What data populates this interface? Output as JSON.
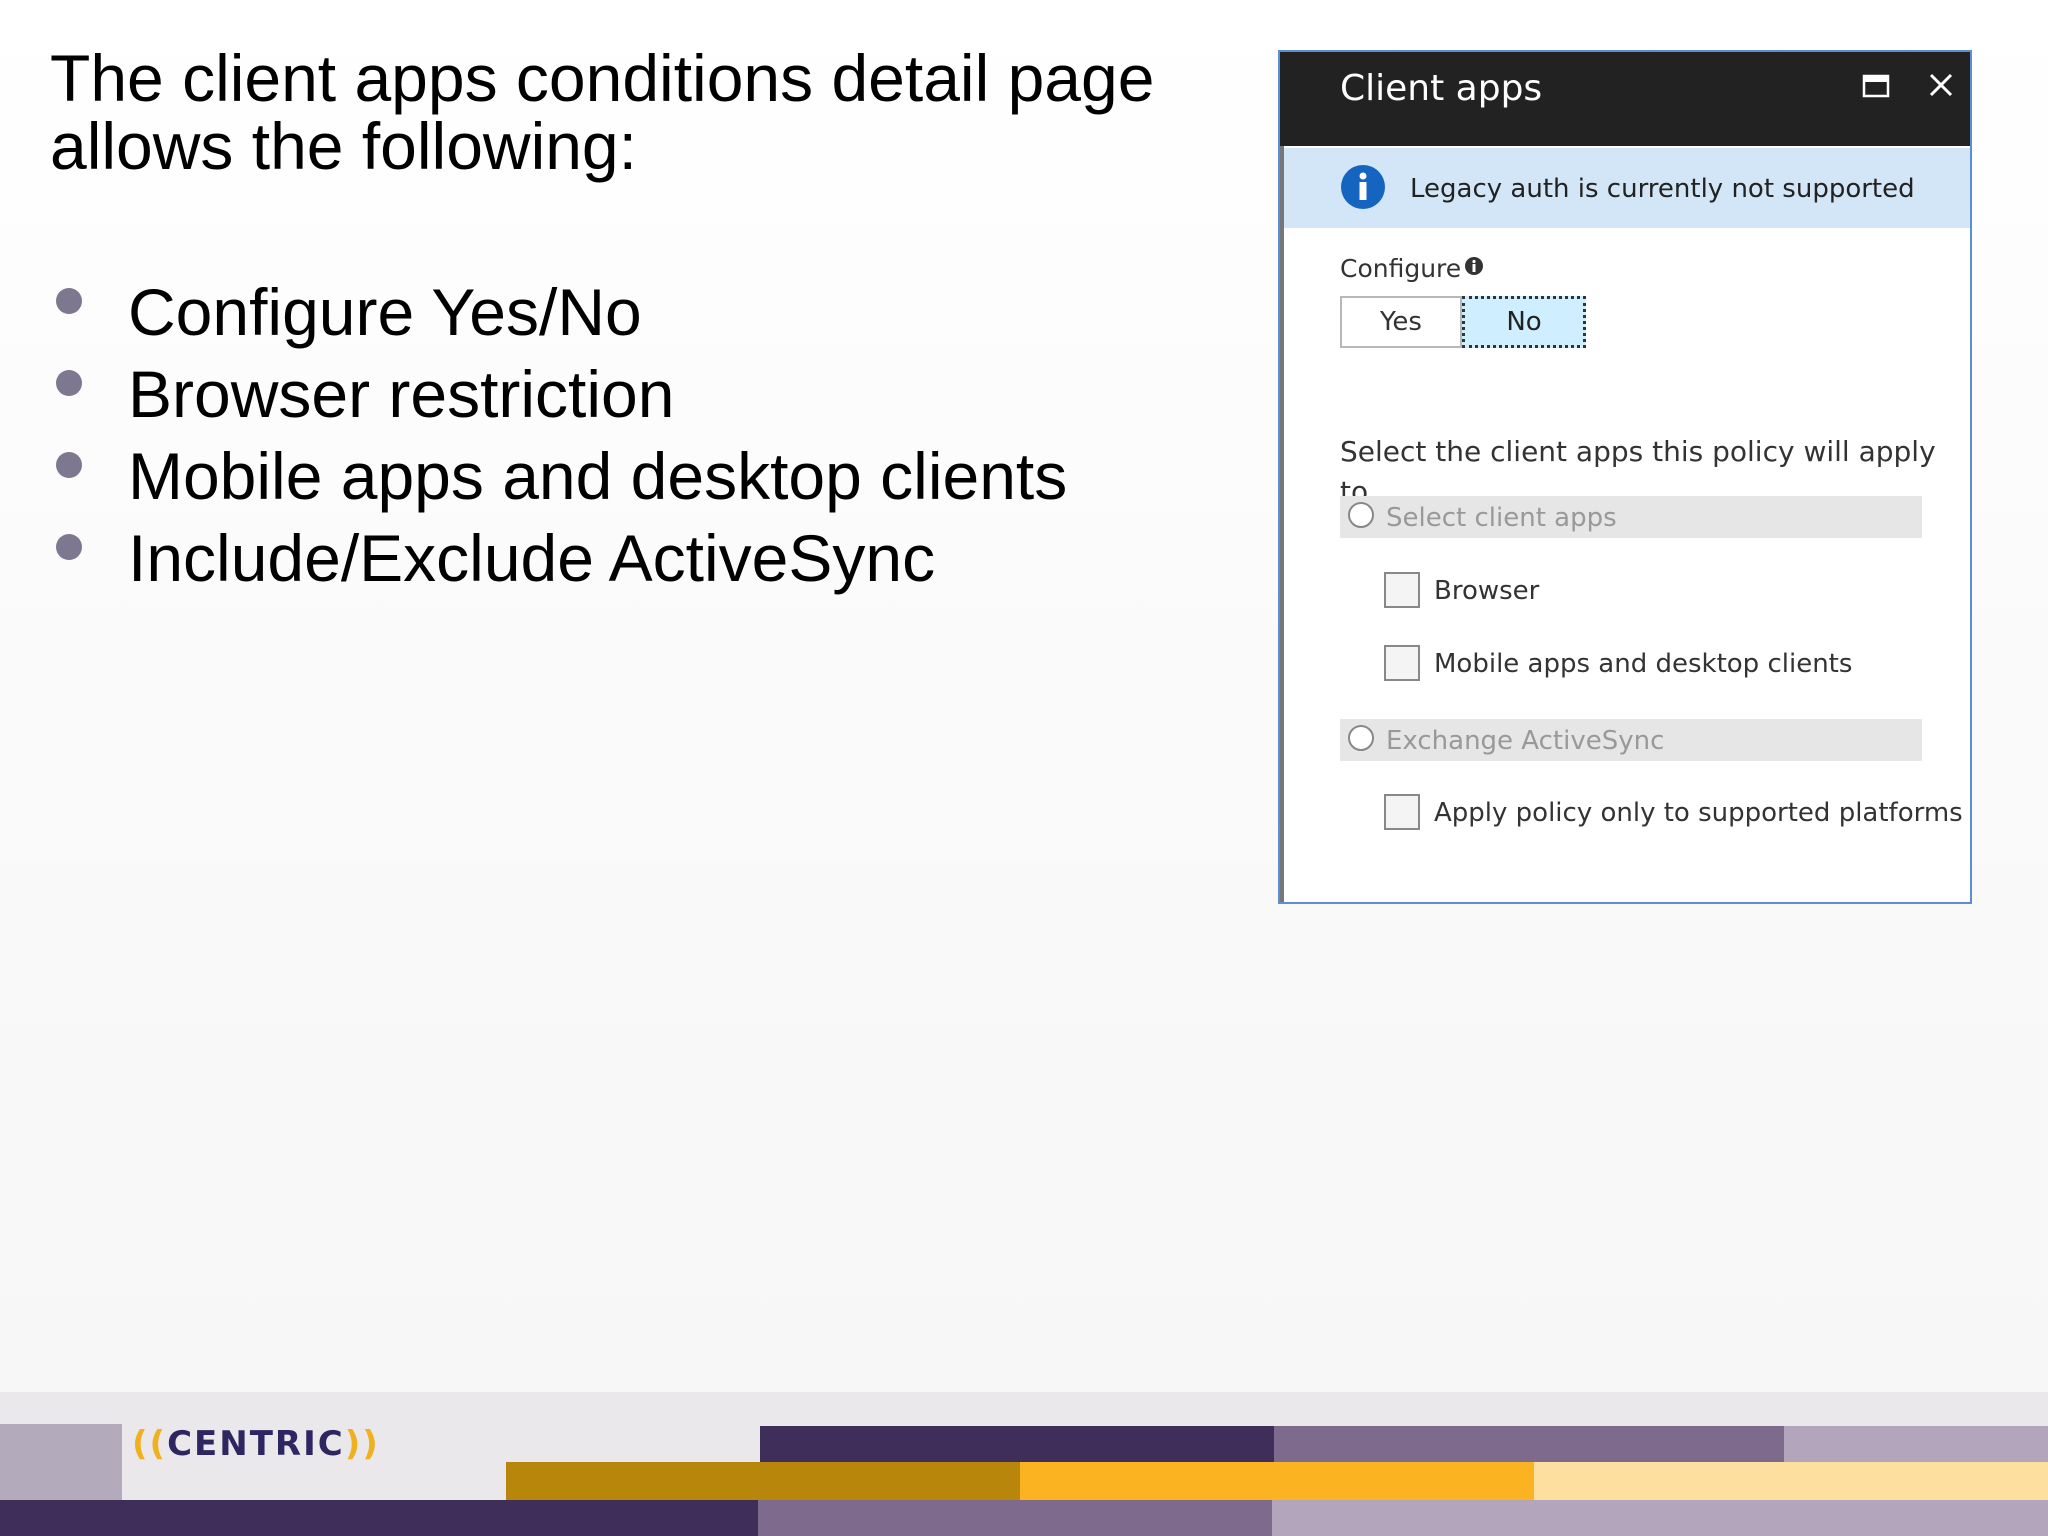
{
  "slide": {
    "title": "The client apps conditions detail page allows the following:",
    "bullets": [
      "Configure Yes/No",
      "Browser restriction",
      "Mobile apps and desktop clients",
      "Include/Exclude ActiveSync"
    ]
  },
  "panel": {
    "title": "Client apps",
    "info_message": "Legacy auth is currently not supported",
    "configure_label": "Configure",
    "toggle": {
      "yes": "Yes",
      "no": "No",
      "selected": "No"
    },
    "description": "Select the client apps this policy will apply to",
    "options": [
      {
        "label": "Select client apps",
        "selected": false,
        "children": [
          {
            "label": "Browser",
            "checked": false
          },
          {
            "label": "Mobile apps and desktop clients",
            "checked": false
          }
        ]
      },
      {
        "label": "Exchange ActiveSync",
        "selected": false,
        "children": [
          {
            "label": "Apply policy only to supported platforms",
            "checked": false
          }
        ]
      }
    ]
  },
  "footer": {
    "logo": {
      "left": "((",
      "word": "CENTRIC",
      "right": "))"
    }
  },
  "colors": {
    "panel_header": "#222222",
    "info_bar": "#d3e6f7",
    "info_icon": "#1565c0",
    "toggle_selected": "#cfeeff",
    "brand_purple_dark": "#3f2d5a",
    "brand_purple_mid": "#7d6a8d",
    "brand_purple_light": "#b3a5bb",
    "brand_gold_dark": "#b8860b",
    "brand_gold": "#fbb321",
    "brand_gold_light": "#fde0a0"
  }
}
